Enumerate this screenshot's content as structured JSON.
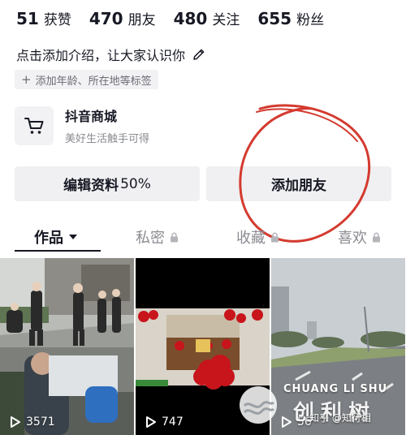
{
  "stats": [
    {
      "num": "51",
      "label": "获赞"
    },
    {
      "num": "470",
      "label": "朋友"
    },
    {
      "num": "480",
      "label": "关注"
    },
    {
      "num": "655",
      "label": "粉丝"
    }
  ],
  "bio": "点击添加介绍，让大家认识你",
  "tag_prompt": "添加年龄、所在地等标签",
  "shop": {
    "title": "抖音商城",
    "subtitle": "美好生活触手可得"
  },
  "buttons": {
    "edit_label": "编辑资料",
    "edit_pct": "50%",
    "add_friends": "添加朋友"
  },
  "tabs": [
    {
      "label": "作品"
    },
    {
      "label": "私密"
    },
    {
      "label": "收藏"
    },
    {
      "label": "喜欢"
    }
  ],
  "videos": [
    {
      "plays": "3571"
    },
    {
      "plays": "747"
    },
    {
      "plays": "56"
    }
  ],
  "watermark": {
    "brand": "CHUANG LI SHU",
    "cn": "创利树",
    "overlay": "知乎 @知行相"
  },
  "colors": {
    "circle_red": "#d43a2f",
    "tab_active": "#161823"
  }
}
